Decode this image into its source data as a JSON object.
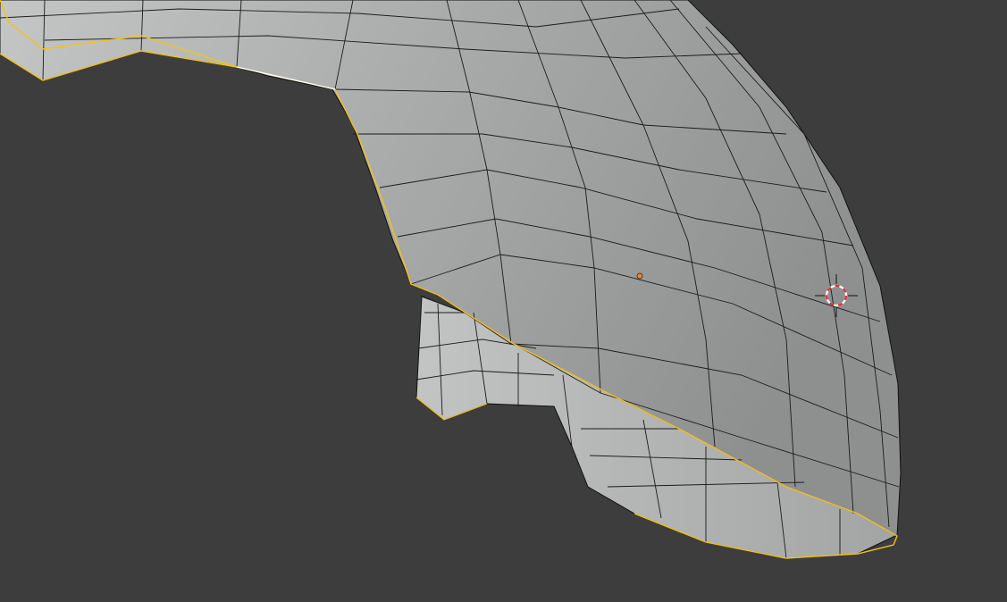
{
  "viewport": {
    "mode": "Edit Mode",
    "background_color": "#3d3d3d",
    "mesh_color": "#a9abab",
    "wire_color": "#111111",
    "selection_outline_color": "#f2c21b",
    "origin_color": "#e8883a",
    "cursor_colors": [
      "#e03030",
      "#ffffff"
    ]
  }
}
